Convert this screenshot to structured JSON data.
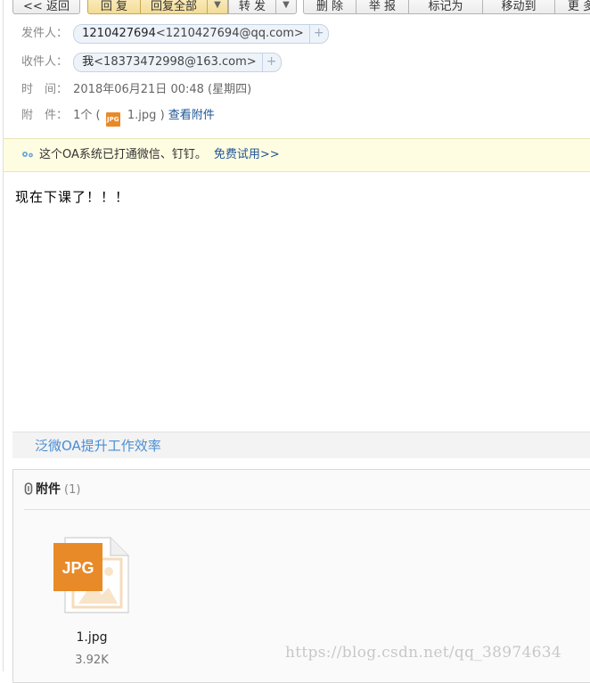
{
  "toolbar": {
    "back": "<< 返回",
    "reply": "回 复",
    "reply_all": "回复全部",
    "forward": "转 发",
    "delete": "删 除",
    "report": "举 报",
    "mark_as": "标记为",
    "move_to": "移动到",
    "more": "更 多"
  },
  "header": {
    "from_label": "发件人：",
    "from_name": "1210427694",
    "from_email": "<1210427694@qq.com>",
    "to_label": "收件人：",
    "to_name": "我",
    "to_email": "<18373472998@163.com>",
    "time_label": "时　间：",
    "time_value": "2018年06月21日 00:48 (星期四)",
    "attach_label": "附　件：",
    "attach_count": "1个 (",
    "attach_file": "1.jpg",
    "attach_close": ")",
    "view_attachments": "查看附件"
  },
  "notice": {
    "text": "这个OA系统已打通微信、钉钉。",
    "link": "免费试用>>"
  },
  "body": {
    "text": "现在下课了！！！"
  },
  "ad": {
    "text": "泛微OA提升工作效率"
  },
  "attachments": {
    "title": "附件",
    "count": "(1)",
    "file_badge": "JPG",
    "file_name": "1.jpg",
    "file_size": "3.92K"
  },
  "watermark": "https://blog.csdn.net/qq_38974634",
  "colors": {
    "link": "#1e5494",
    "primary_btn": "#f3dc95",
    "jpg_orange": "#e88a28",
    "ad_text": "#4a8ed4"
  }
}
